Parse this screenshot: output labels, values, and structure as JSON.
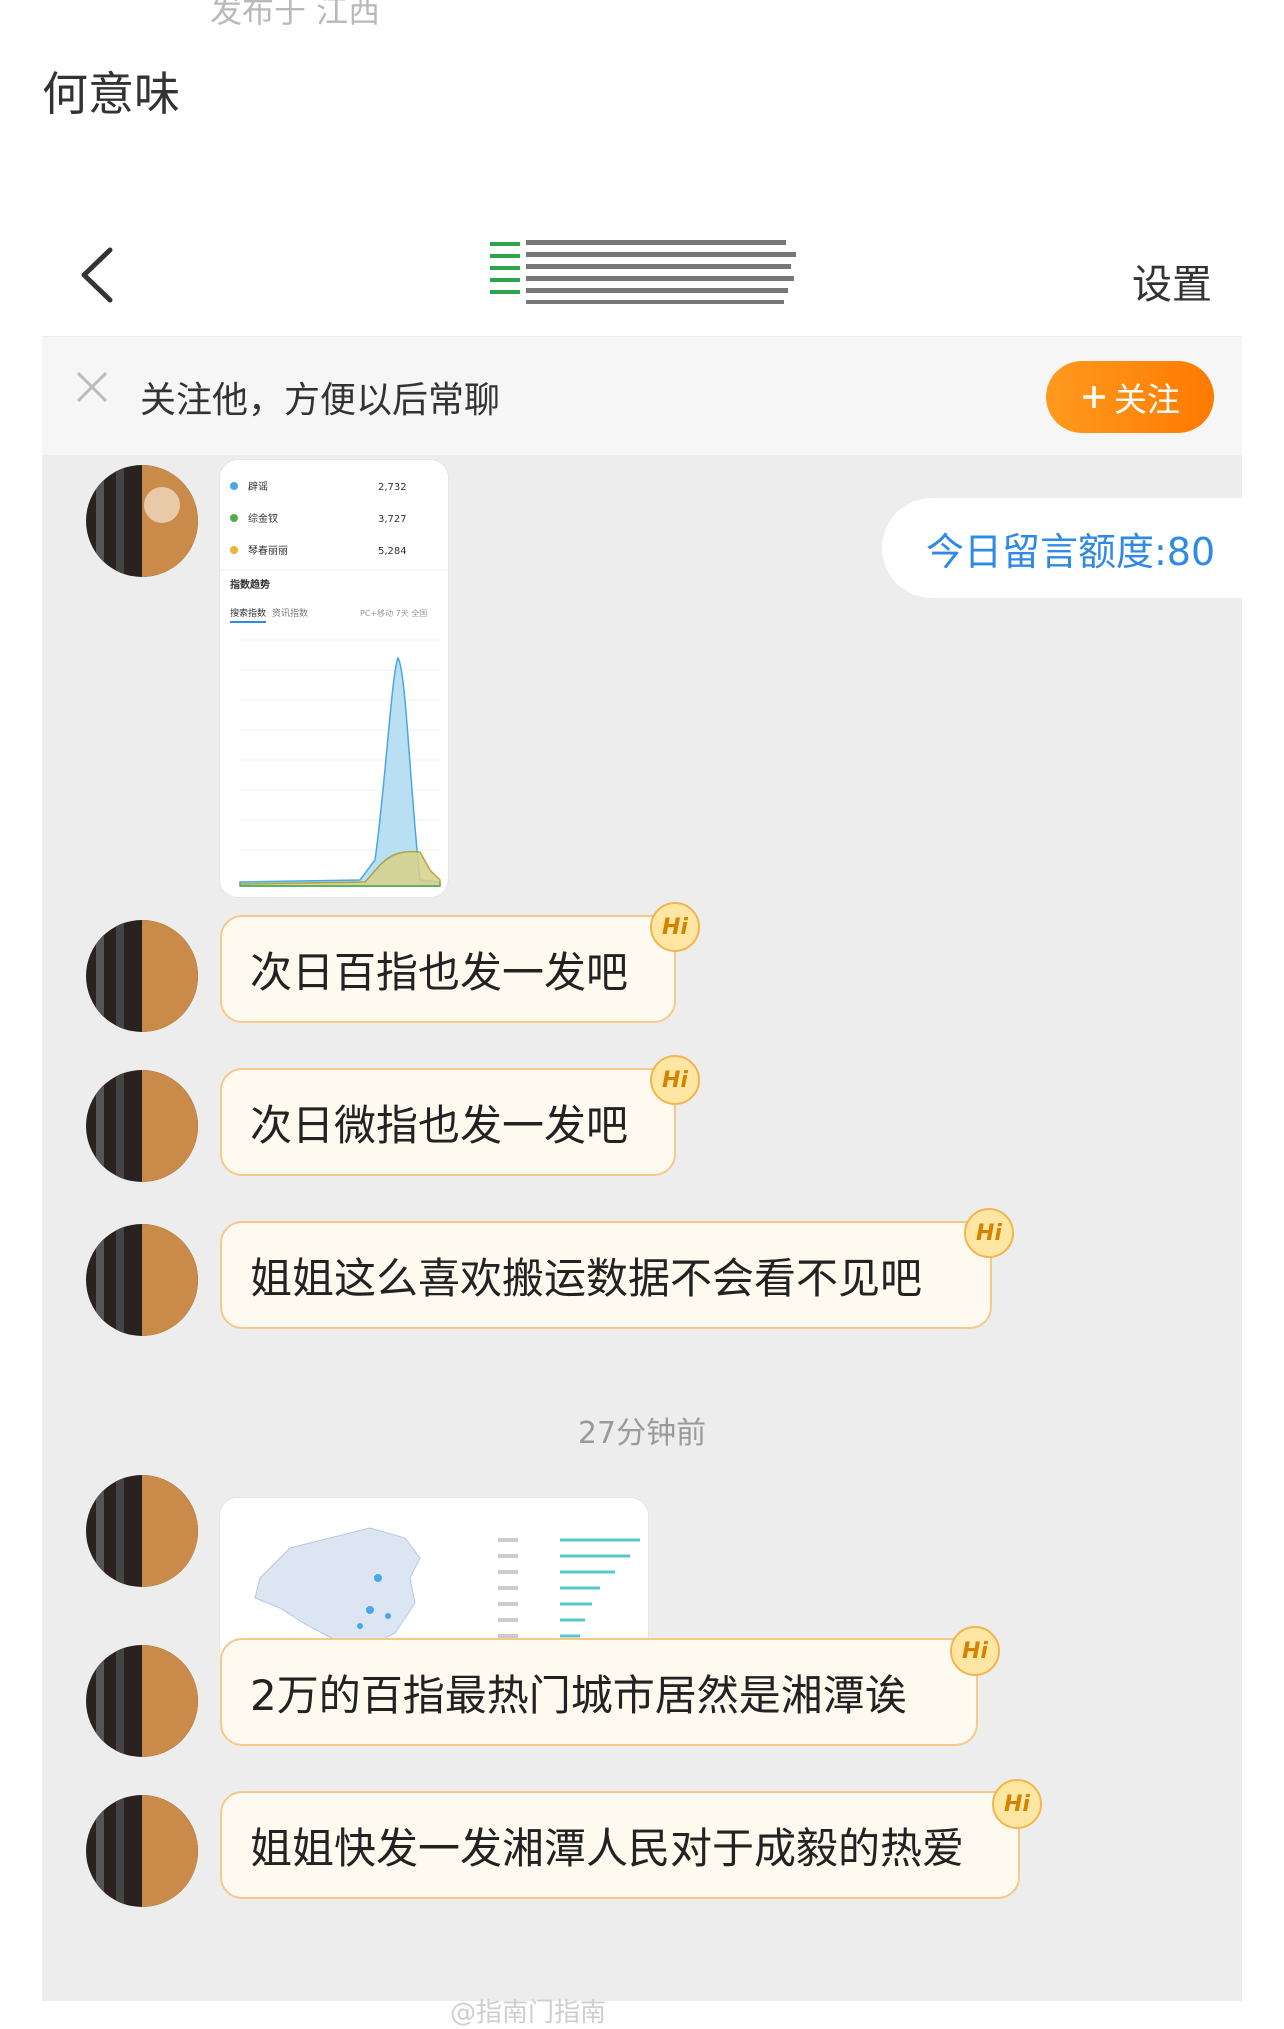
{
  "post": {
    "meta": "发布于 江西",
    "text": "何意味"
  },
  "nav": {
    "settings_label": "设置"
  },
  "follow_bar": {
    "text": "关注他，方便以后常聊",
    "button_label": "关注",
    "button_icon": "plus-icon"
  },
  "quota": {
    "label": "今日留言额度:80"
  },
  "stats_card": {
    "rows": [
      {
        "name": "辟谣",
        "value": "2,732",
        "color": "#4aa7e6"
      },
      {
        "name": "综金钗",
        "value": "3,727",
        "color": "#4caf50"
      },
      {
        "name": "琴春丽丽",
        "value": "5,284",
        "color": "#f2b03a"
      }
    ],
    "section_title": "指数趋势",
    "tabs": [
      "搜索指数",
      "资讯指数"
    ],
    "filter": "PC+移动 7天 全国"
  },
  "messages": [
    {
      "text": "次日百指也发一发吧",
      "badge": "Hi"
    },
    {
      "text": "次日微指也发一发吧",
      "badge": "Hi"
    },
    {
      "text": "姐姐这么喜欢搬运数据不会看不见吧",
      "badge": "Hi"
    },
    {
      "text": "2万的百指最热门城市居然是湘潭诶",
      "badge": "Hi"
    },
    {
      "text": "姐姐快发一发湘潭人民对于成毅的热爱",
      "badge": "Hi"
    }
  ],
  "time_separator": "27分钟前",
  "watermark": "@指南门指南"
}
